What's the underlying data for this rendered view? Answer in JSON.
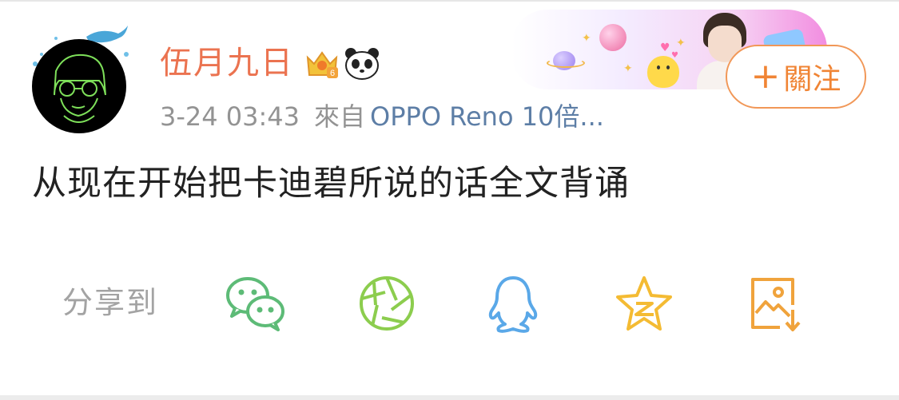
{
  "post": {
    "username": "伍月九日",
    "timestamp": "3-24 03:43",
    "from_label": "來自",
    "source": "OPPO Reno 10倍...",
    "content": "从现在开始把卡迪碧所说的话全文背诵"
  },
  "follow_button": {
    "plus": "+",
    "label": "關注"
  },
  "share": {
    "label": "分享到",
    "targets": [
      {
        "name": "wechat",
        "icon": "wechat-icon",
        "color": "#5dbb77"
      },
      {
        "name": "moments",
        "icon": "moments-shutter-icon",
        "color": "#8ccd4e"
      },
      {
        "name": "qq",
        "icon": "qq-penguin-icon",
        "color": "#5aa8e8"
      },
      {
        "name": "qzone",
        "icon": "qzone-star-icon",
        "color": "#f4bb33"
      },
      {
        "name": "save-image",
        "icon": "save-image-icon",
        "color": "#f0a33c"
      }
    ]
  },
  "colors": {
    "username": "#eb7350",
    "source_link": "#5d7ea6",
    "follow_accent": "#f08434",
    "meta_text": "#939393"
  }
}
